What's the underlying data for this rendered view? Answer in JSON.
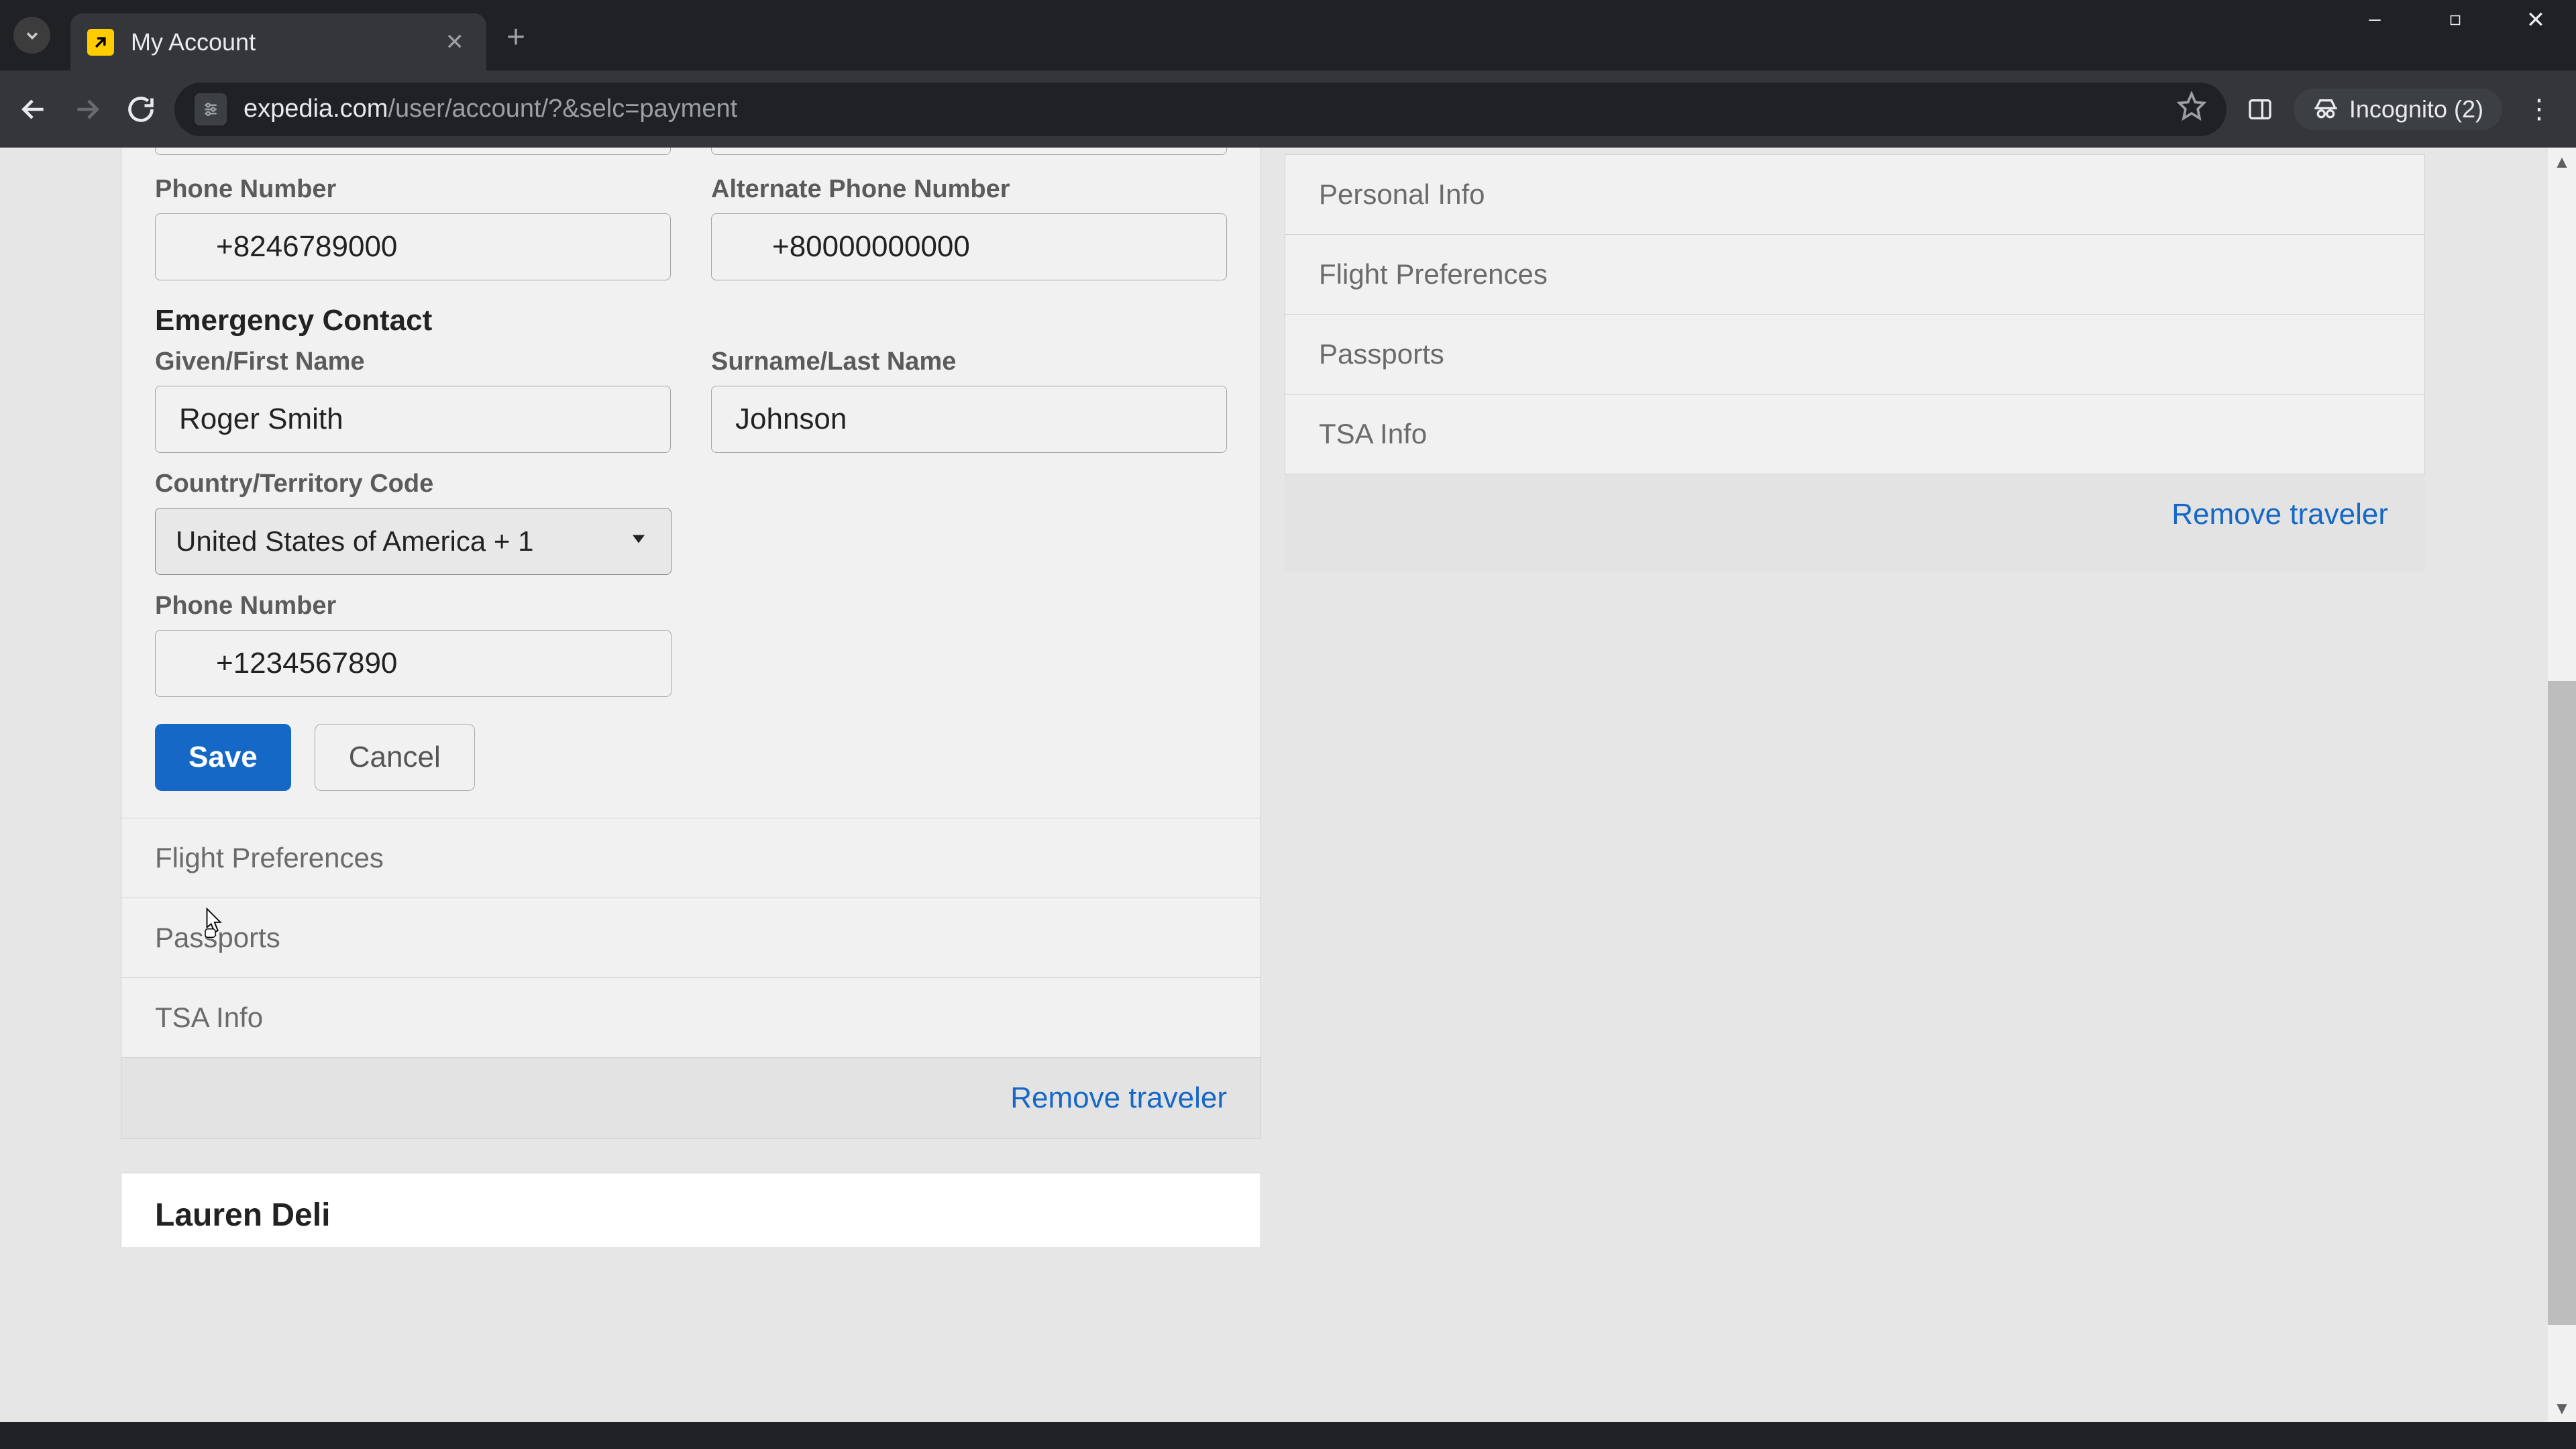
{
  "browser": {
    "tab_title": "My Account",
    "url_domain": "expedia.com",
    "url_path": "/user/account/?&selc=payment",
    "incognito_label": "Incognito (2)"
  },
  "form": {
    "phone_label": "Phone Number",
    "phone_value": "+8246789000",
    "alt_phone_label": "Alternate Phone Number",
    "alt_phone_value": "+80000000000",
    "emergency_heading": "Emergency Contact",
    "first_name_label": "Given/First Name",
    "first_name_value": "Roger Smith",
    "last_name_label": "Surname/Last Name",
    "last_name_value": "Johnson",
    "country_label": "Country/Territory Code",
    "country_value": "United States of America + 1",
    "em_phone_label": "Phone Number",
    "em_phone_value": "+1234567890",
    "save_label": "Save",
    "cancel_label": "Cancel"
  },
  "left_sections": {
    "flight_prefs": "Flight Preferences",
    "passports": "Passports",
    "tsa": "TSA Info",
    "remove": "Remove traveler"
  },
  "next_traveler": "Lauren Deli",
  "right_sections": {
    "personal": "Personal Info",
    "flight_prefs": "Flight Preferences",
    "passports": "Passports",
    "tsa": "TSA Info",
    "remove": "Remove traveler"
  },
  "colors": {
    "primary": "#1668c7",
    "bg": "#e6e6e6"
  }
}
